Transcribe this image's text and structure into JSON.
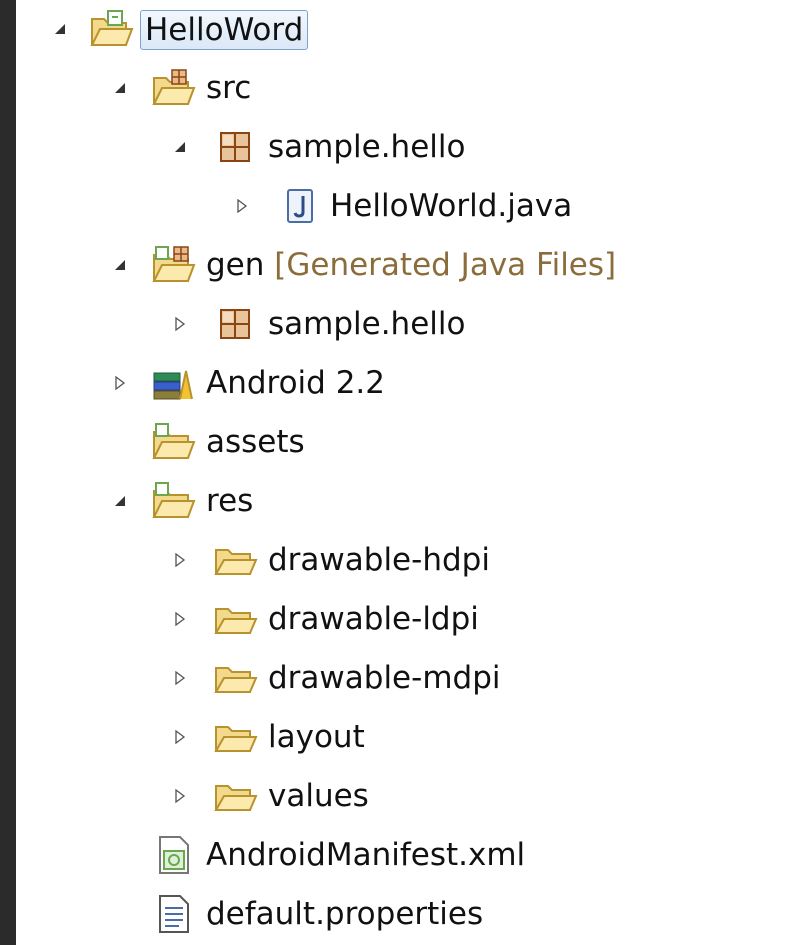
{
  "tree": [
    {
      "key": "helloword",
      "label": "HelloWord",
      "sub": "",
      "twisty": "expanded",
      "icon": "project-folder-icon"
    },
    {
      "key": "src",
      "label": "src",
      "sub": "",
      "twisty": "expanded",
      "icon": "source-folder-icon"
    },
    {
      "key": "pkg1",
      "label": "sample.hello",
      "sub": "",
      "twisty": "expanded",
      "icon": "package-icon"
    },
    {
      "key": "helloworld",
      "label": "HelloWorld.java",
      "sub": "",
      "twisty": "collapsed",
      "icon": "java-file-icon"
    },
    {
      "key": "gen",
      "label": "gen",
      "sub": "[Generated Java Files]",
      "twisty": "expanded",
      "icon": "generated-source-folder-icon"
    },
    {
      "key": "pkg2",
      "label": "sample.hello",
      "sub": "",
      "twisty": "collapsed",
      "icon": "package-icon"
    },
    {
      "key": "android",
      "label": "Android 2.2",
      "sub": "",
      "twisty": "collapsed",
      "icon": "library-icon"
    },
    {
      "key": "assets",
      "label": "assets",
      "sub": "",
      "twisty": "none",
      "icon": "android-folder-icon"
    },
    {
      "key": "res",
      "label": "res",
      "sub": "",
      "twisty": "expanded",
      "icon": "android-folder-icon"
    },
    {
      "key": "hdpi",
      "label": "drawable-hdpi",
      "sub": "",
      "twisty": "collapsed",
      "icon": "folder-icon"
    },
    {
      "key": "ldpi",
      "label": "drawable-ldpi",
      "sub": "",
      "twisty": "collapsed",
      "icon": "folder-icon"
    },
    {
      "key": "mdpi",
      "label": "drawable-mdpi",
      "sub": "",
      "twisty": "collapsed",
      "icon": "folder-icon"
    },
    {
      "key": "layout",
      "label": "layout",
      "sub": "",
      "twisty": "collapsed",
      "icon": "folder-icon"
    },
    {
      "key": "values",
      "label": "values",
      "sub": "",
      "twisty": "collapsed",
      "icon": "folder-icon"
    },
    {
      "key": "manifest",
      "label": "AndroidManifest.xml",
      "sub": "",
      "twisty": "none",
      "icon": "android-manifest-icon"
    },
    {
      "key": "props",
      "label": "default.properties",
      "sub": "",
      "twisty": "none",
      "icon": "properties-file-icon"
    }
  ],
  "colors": {
    "selection_border": "#7da2ce",
    "folder": "#f3d98c",
    "folder_edge": "#b8922d",
    "decorator": "#6aa84f",
    "package": "#c0864a",
    "sub_label": "#8a6d3b"
  }
}
